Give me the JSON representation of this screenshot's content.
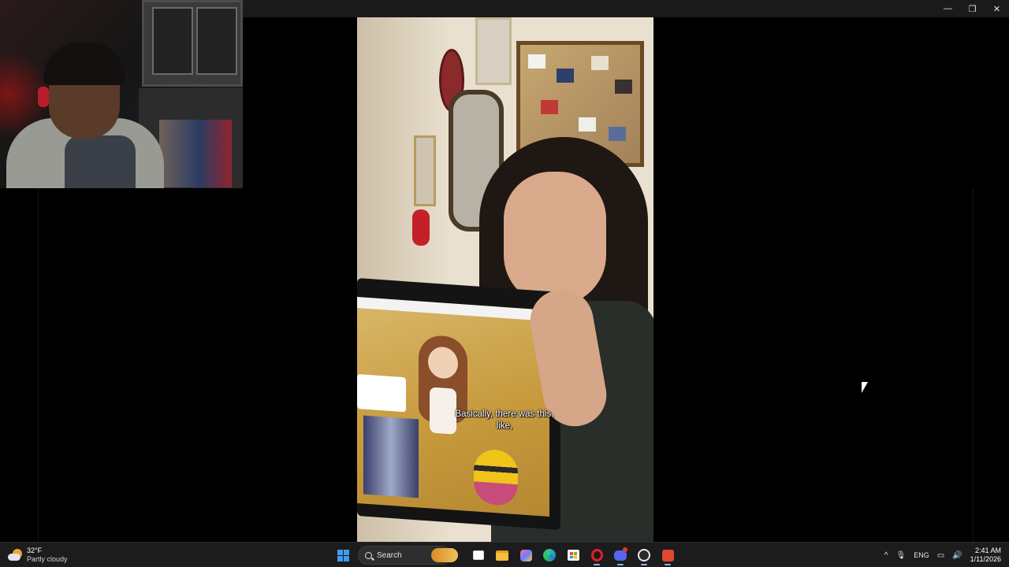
{
  "window": {
    "controls": {
      "minimize_glyph": "—",
      "restore_glyph": "❐",
      "close_glyph": "✕"
    }
  },
  "video": {
    "subtitle_line1": "Basically, there was this,",
    "subtitle_line2": "like,"
  },
  "taskbar": {
    "weather": {
      "temperature": "32°F",
      "condition": "Partly cloudy"
    },
    "search": {
      "label": "Search"
    },
    "pinned_apps": [
      {
        "icon": "task-view-icon"
      },
      {
        "icon": "file-explorer-icon"
      },
      {
        "icon": "paint-app-icon"
      },
      {
        "icon": "edge-browser-icon"
      },
      {
        "icon": "microsoft-store-icon"
      },
      {
        "icon": "opera-gx-icon"
      },
      {
        "icon": "discord-icon"
      },
      {
        "icon": "obs-studio-icon"
      },
      {
        "icon": "stream-app-icon"
      }
    ],
    "tray": {
      "overflow_glyph": "^",
      "language": "ENG",
      "time": "2:41 AM",
      "date": "1/11/2026"
    }
  },
  "colors": {
    "taskbar_bg": "#1c1c1c",
    "accent_blue": "#3f9bf2",
    "video_wall": "#e9e0cf"
  }
}
